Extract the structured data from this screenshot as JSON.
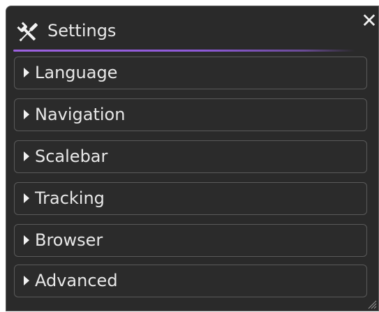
{
  "panel": {
    "title": "Settings",
    "title_icon": "tools-icon",
    "close_label": "✕",
    "accent_color": "#9d62e0"
  },
  "sections": [
    {
      "label": "Language"
    },
    {
      "label": "Navigation"
    },
    {
      "label": "Scalebar"
    },
    {
      "label": "Tracking"
    },
    {
      "label": "Browser"
    },
    {
      "label": "Advanced"
    }
  ],
  "colors": {
    "panel_bg": "#2a2a2a",
    "border": "#5a5a5a",
    "text": "#e8e8e8"
  }
}
